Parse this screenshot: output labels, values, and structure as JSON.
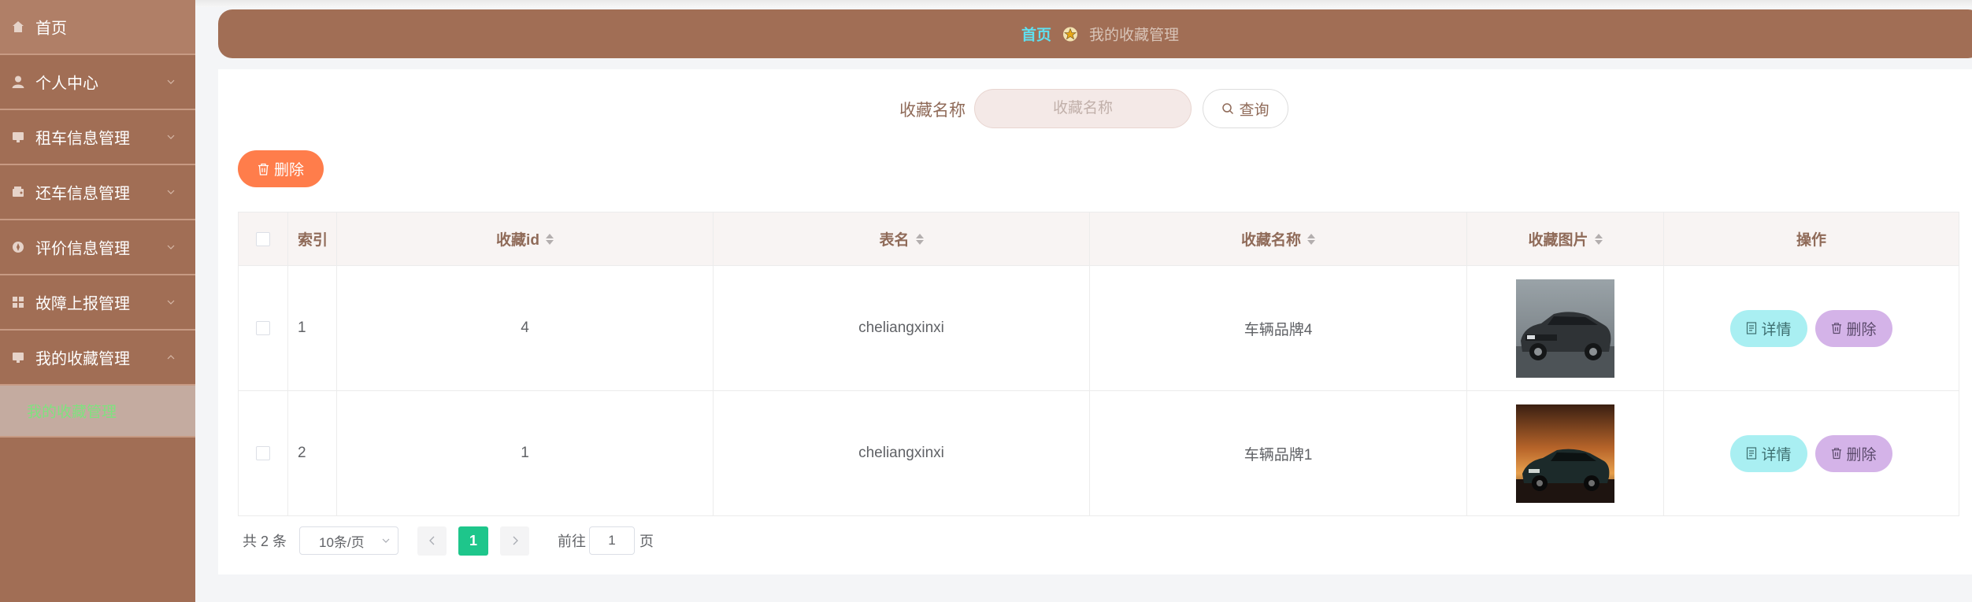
{
  "sidebar": {
    "items": [
      {
        "label": "首页",
        "icon": "home-icon"
      },
      {
        "label": "个人中心",
        "icon": "user-icon"
      },
      {
        "label": "租车信息管理",
        "icon": "monitor-icon"
      },
      {
        "label": "还车信息管理",
        "icon": "wallet-icon"
      },
      {
        "label": "评价信息管理",
        "icon": "compass-icon"
      },
      {
        "label": "故障上报管理",
        "icon": "grid-icon"
      },
      {
        "label": "我的收藏管理",
        "icon": "monitor-icon"
      }
    ],
    "submenu_active": "我的收藏管理"
  },
  "breadcrumb": {
    "home": "首页",
    "current": "我的收藏管理"
  },
  "search": {
    "label": "收藏名称",
    "placeholder": "收藏名称",
    "button": "查询"
  },
  "toolbar": {
    "delete_label": "删除"
  },
  "table": {
    "headers": {
      "index": "索引",
      "id": "收藏id",
      "table_name": "表名",
      "name": "收藏名称",
      "image": "收藏图片",
      "actions": "操作"
    },
    "rows": [
      {
        "index": "1",
        "id": "4",
        "table_name": "cheliangxinxi",
        "name": "车辆品牌4",
        "detail": "详情",
        "delete": "删除"
      },
      {
        "index": "2",
        "id": "1",
        "table_name": "cheliangxinxi",
        "name": "车辆品牌1",
        "detail": "详情",
        "delete": "删除"
      }
    ]
  },
  "pagination": {
    "total": "共 2 条",
    "page_size": "10条/页",
    "current_page": "1",
    "goto_label": "前往",
    "goto_value": "1",
    "page_suffix": "页"
  },
  "colors": {
    "sidebar": "#a16e55",
    "active_page": "#1ec68b",
    "delete_button": "#ff7d4b",
    "detail_button": "#a9eff2",
    "row_delete_button": "#d4b3e8"
  }
}
